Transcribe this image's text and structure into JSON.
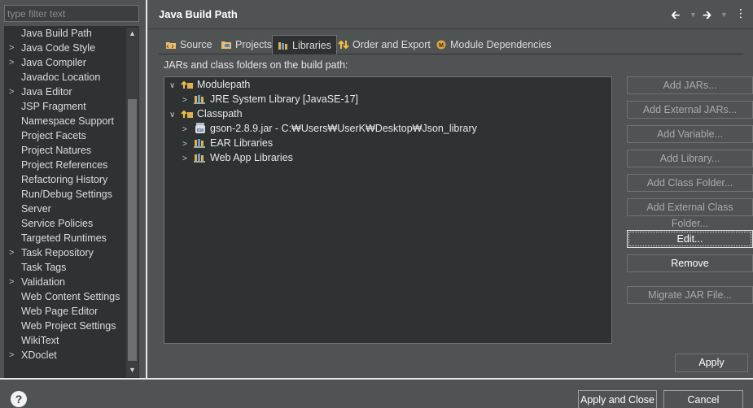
{
  "filter": {
    "placeholder": "type filter text"
  },
  "nav": {
    "items": [
      {
        "label": "Java Build Path",
        "expandable": false
      },
      {
        "label": "Java Code Style",
        "expandable": true
      },
      {
        "label": "Java Compiler",
        "expandable": true
      },
      {
        "label": "Javadoc Location",
        "expandable": false
      },
      {
        "label": "Java Editor",
        "expandable": true
      },
      {
        "label": "JSP Fragment",
        "expandable": false
      },
      {
        "label": "Namespace Support",
        "expandable": false
      },
      {
        "label": "Project Facets",
        "expandable": false
      },
      {
        "label": "Project Natures",
        "expandable": false
      },
      {
        "label": "Project References",
        "expandable": false
      },
      {
        "label": "Refactoring History",
        "expandable": false
      },
      {
        "label": "Run/Debug Settings",
        "expandable": false
      },
      {
        "label": "Server",
        "expandable": false
      },
      {
        "label": "Service Policies",
        "expandable": false
      },
      {
        "label": "Targeted Runtimes",
        "expandable": false
      },
      {
        "label": "Task Repository",
        "expandable": true
      },
      {
        "label": "Task Tags",
        "expandable": false
      },
      {
        "label": "Validation",
        "expandable": true
      },
      {
        "label": "Web Content Settings",
        "expandable": false
      },
      {
        "label": "Web Page Editor",
        "expandable": false
      },
      {
        "label": "Web Project Settings",
        "expandable": false
      },
      {
        "label": "WikiText",
        "expandable": false
      },
      {
        "label": "XDoclet",
        "expandable": true
      }
    ]
  },
  "header": {
    "title": "Java Build Path"
  },
  "tabs": [
    {
      "label": "Source",
      "icon": "source-folder-icon"
    },
    {
      "label": "Projects",
      "icon": "projects-folder-icon"
    },
    {
      "label": "Libraries",
      "icon": "libraries-icon"
    },
    {
      "label": "Order and Export",
      "icon": "order-export-icon"
    },
    {
      "label": "Module Dependencies",
      "icon": "module-icon"
    }
  ],
  "panel": {
    "label": "JARs and class folders on the build path:",
    "tree": [
      {
        "label": "Modulepath",
        "icon": "path-root-icon"
      },
      {
        "label": "JRE System Library [JavaSE-17]",
        "icon": "library-icon"
      },
      {
        "label": "Classpath",
        "icon": "path-root-icon"
      },
      {
        "label": "gson-2.8.9.jar - C:₩Users₩UserK₩Desktop₩Json_library",
        "icon": "jar-icon"
      },
      {
        "label": "EAR Libraries",
        "icon": "library-icon"
      },
      {
        "label": "Web App Libraries",
        "icon": "library-icon"
      }
    ]
  },
  "buttons": {
    "add_jars": "Add JARs...",
    "add_external_jars": "Add External JARs...",
    "add_variable": "Add Variable...",
    "add_library": "Add Library...",
    "add_class_folder": "Add Class Folder...",
    "add_external_class_folder": "Add External Class Folder...",
    "edit": "Edit...",
    "remove": "Remove",
    "migrate_jar": "Migrate JAR File...",
    "apply": "Apply"
  },
  "footer": {
    "apply_and_close": "Apply and Close",
    "cancel": "Cancel"
  },
  "colors": {
    "background": "#505354",
    "tree_background": "#2f3233",
    "border": "#6f7375",
    "text": "#dcdcdc",
    "disabled_text": "#a8abad"
  }
}
